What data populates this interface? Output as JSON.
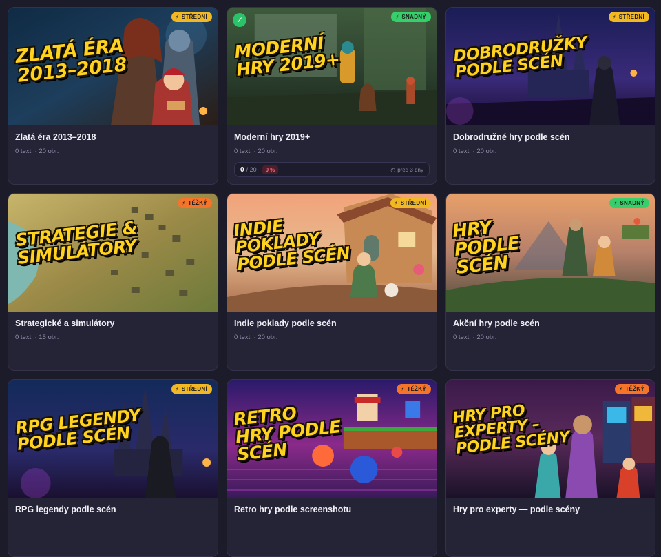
{
  "cards": [
    {
      "thumb_title": "Zlatá éra\n2013–2018",
      "title": "Zlatá éra 2013–2018",
      "meta": "0 text. · 20 obr.",
      "badge": "Střední",
      "badge_color": "#f2b824",
      "badge_icon": "bolt-icon"
    },
    {
      "thumb_title": "Moderní\nhry 2019+",
      "title": "Moderní hry 2019+",
      "meta": "0 text. · 20 obr.",
      "badge": "Snadný",
      "badge_color": "#35d06b",
      "badge_icon": "bolt-icon",
      "completed": true,
      "progress": {
        "done": "0",
        "total": "/ 20",
        "percent": "0 %",
        "time": "před 3 dny"
      }
    },
    {
      "thumb_title": "Dobrodružky\npodle scén",
      "title": "Dobrodružné hry podle scén",
      "meta": "0 text. · 20 obr.",
      "badge": "Střední",
      "badge_color": "#f2b824",
      "badge_icon": "bolt-icon"
    },
    {
      "thumb_title": "Strategie &\nsimulátory",
      "title": "Strategické a simulátory",
      "meta": "0 text. · 15 obr.",
      "badge": "Těžký",
      "badge_color": "#f4742a",
      "badge_icon": "bolt-icon"
    },
    {
      "thumb_title": "Indie\npoklady\npodle scén",
      "title": "Indie poklady podle scén",
      "meta": "0 text. · 20 obr.",
      "badge": "Střední",
      "badge_color": "#f2b824",
      "badge_icon": "bolt-icon"
    },
    {
      "thumb_title": "Hry\npodle\nscén",
      "title": "Akční hry podle scén",
      "meta": "0 text. · 20 obr.",
      "badge": "Snadný",
      "badge_color": "#35d06b",
      "badge_icon": "bolt-icon"
    },
    {
      "thumb_title": "RPG legendy\npodle scén",
      "title": "RPG legendy podle scén",
      "meta": "",
      "badge": "Střední",
      "badge_color": "#f2b824",
      "badge_icon": "bolt-icon"
    },
    {
      "thumb_title": "Retro\nhry podle\nscén",
      "title": "Retro hry podle screenshotu",
      "meta": "",
      "badge": "Těžký",
      "badge_color": "#f4742a",
      "badge_icon": "bolt-icon"
    },
    {
      "thumb_title": "Hry pro\nexperty –\npodle scény",
      "title": "Hry pro experty — podle scény",
      "meta": "",
      "badge": "Těžký",
      "badge_color": "#f4742a",
      "badge_icon": "bolt-icon"
    }
  ]
}
